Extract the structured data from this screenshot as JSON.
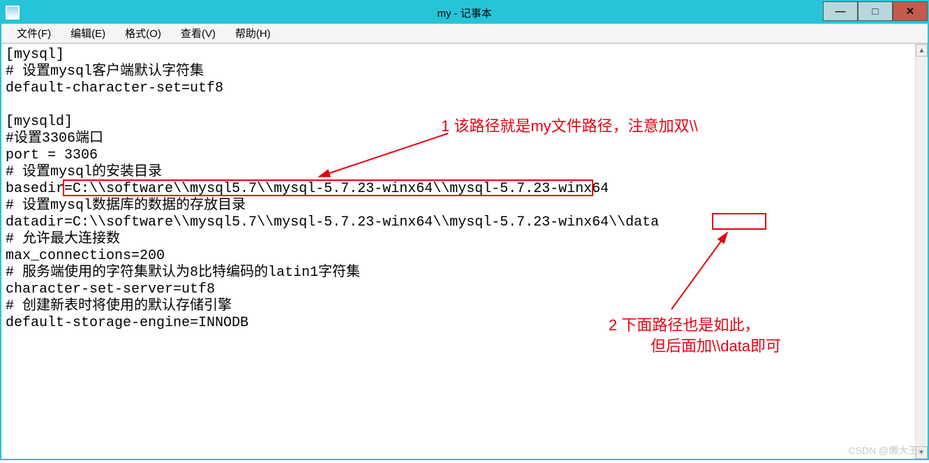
{
  "window": {
    "title": "my - 记事本"
  },
  "menubar": {
    "file": "文件(F)",
    "edit": "编辑(E)",
    "format": "格式(O)",
    "view": "查看(V)",
    "help": "帮助(H)"
  },
  "editor": {
    "lines": [
      "[mysql]",
      "# 设置mysql客户端默认字符集",
      "default-character-set=utf8",
      "",
      "[mysqld]",
      "#设置3306端口",
      "port = 3306",
      "# 设置mysql的安装目录",
      "basedir=C:\\\\software\\\\mysql5.7\\\\mysql-5.7.23-winx64\\\\mysql-5.7.23-winx64",
      "# 设置mysql数据库的数据的存放目录",
      "datadir=C:\\\\software\\\\mysql5.7\\\\mysql-5.7.23-winx64\\\\mysql-5.7.23-winx64\\\\data",
      "# 允许最大连接数",
      "max_connections=200",
      "# 服务端使用的字符集默认为8比特编码的latin1字符集",
      "character-set-server=utf8",
      "# 创建新表时将使用的默认存储引擎",
      "default-storage-engine=INNODB"
    ]
  },
  "annotations": {
    "a1": "1 该路径就是my文件路径，注意加双\\\\",
    "a2_line1": "2 下面路径也是如此，",
    "a2_line2": "但后面加\\\\data即可"
  },
  "watermark": "CSDN @懒大王o"
}
